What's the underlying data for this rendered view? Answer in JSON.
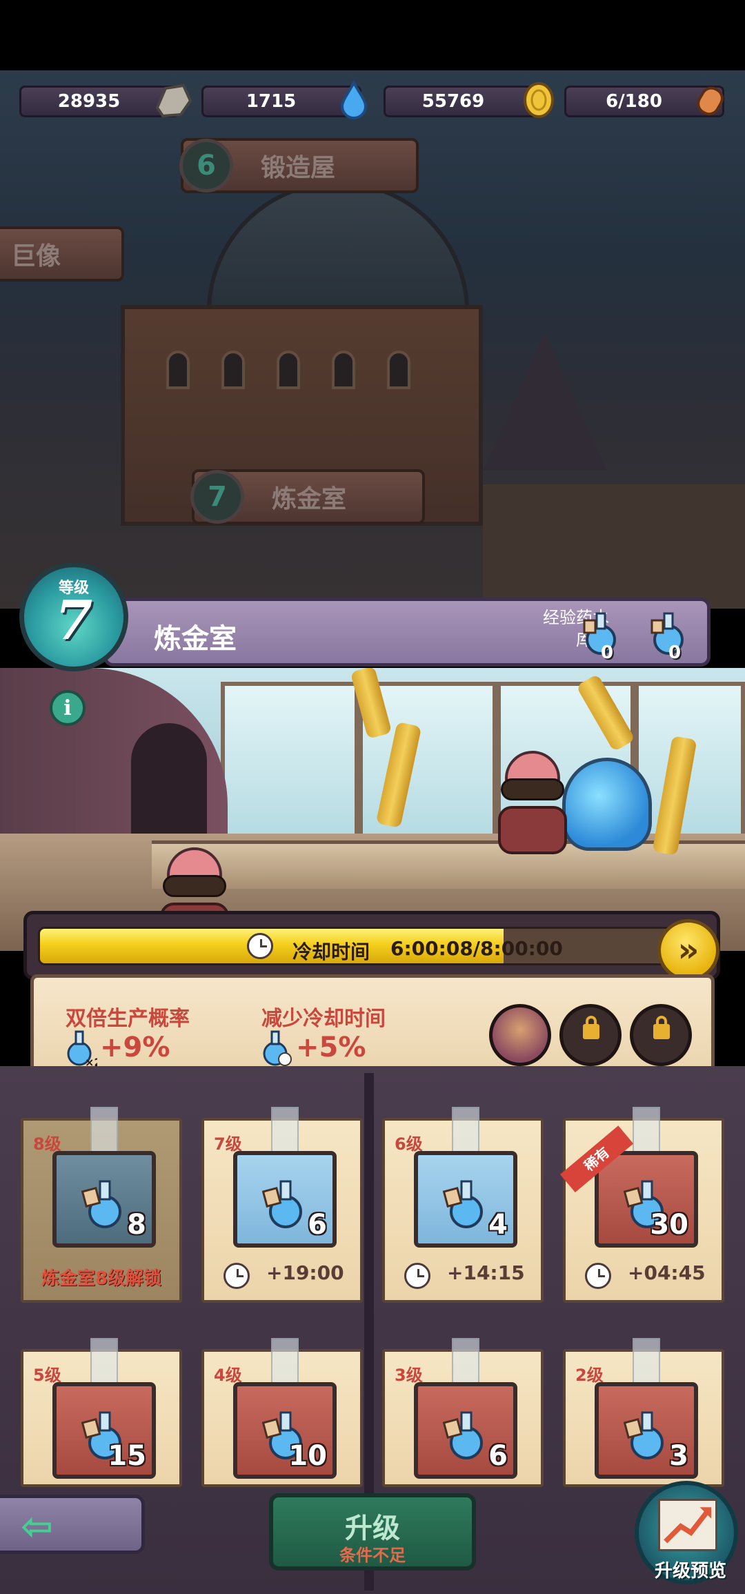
{
  "resources": [
    {
      "value": "28935",
      "icon": "stone-icon"
    },
    {
      "value": "1715",
      "icon": "water-drop-icon"
    },
    {
      "value": "55769",
      "icon": "coin-icon"
    },
    {
      "value": "6/180",
      "icon": "bread-icon"
    }
  ],
  "map": {
    "forge_sign": {
      "level": "6",
      "name": "锻造屋"
    },
    "statue_sign": {
      "name": "巨像"
    },
    "lab_sign": {
      "level": "7",
      "name": "炼金室"
    }
  },
  "building": {
    "level_label": "等级",
    "level": "7",
    "name": "炼金室",
    "exp_potion_label": "经验药水",
    "stock_label": "库存",
    "potion_counts": [
      "0",
      "0"
    ]
  },
  "cooldown": {
    "label": "冷却时间",
    "value": "6:00:08/8:00:00",
    "progress": 0.72
  },
  "bonuses": [
    {
      "label": "双倍生产概率",
      "value": "+9%",
      "icon": "potion-x2-icon"
    },
    {
      "label": "减少冷却时间",
      "value": "+5%",
      "icon": "potion-clock-icon"
    }
  ],
  "cards": [
    {
      "level": "8级",
      "count": "8",
      "frame": "dark",
      "locked": true,
      "unlock_text": "炼金室8级解锁"
    },
    {
      "level": "7级",
      "count": "6",
      "frame": "blue",
      "time": "+19:00"
    },
    {
      "level": "6级",
      "count": "4",
      "frame": "blue",
      "time": "+14:15"
    },
    {
      "level": "",
      "count": "30",
      "frame": "red",
      "time": "+04:45",
      "ribbon": "稀有"
    },
    {
      "level": "5级",
      "count": "15",
      "frame": "red"
    },
    {
      "level": "4级",
      "count": "10",
      "frame": "red"
    },
    {
      "level": "3级",
      "count": "6",
      "frame": "red"
    },
    {
      "level": "2级",
      "count": "3",
      "frame": "red"
    }
  ],
  "bottom": {
    "upgrade_label": "升级",
    "upgrade_sub": "条件不足",
    "preview_label": "升级预览"
  },
  "colors": {
    "accent_red": "#c9473c",
    "progress_yellow": "#f4cf1c",
    "upgrade_green": "#2f7a5c"
  }
}
